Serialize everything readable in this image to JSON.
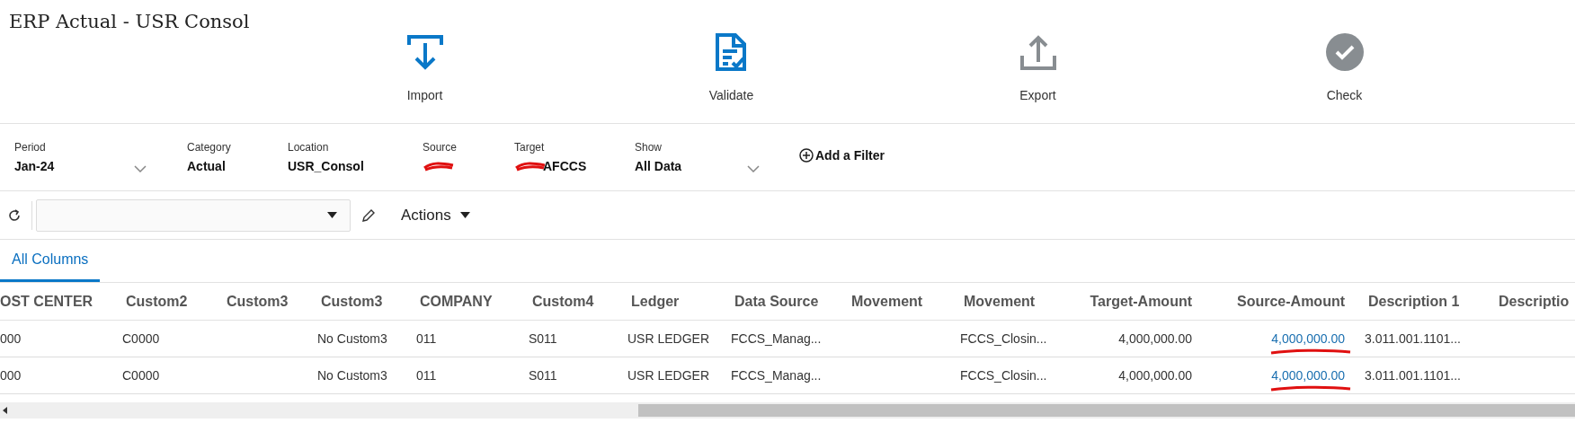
{
  "title": "ERP Actual - USR Consol",
  "actions": [
    {
      "label": "Import",
      "kind": "import",
      "disabled": false
    },
    {
      "label": "Validate",
      "kind": "validate",
      "disabled": false
    },
    {
      "label": "Export",
      "kind": "export",
      "disabled": true
    },
    {
      "label": "Check",
      "kind": "check",
      "disabled": true
    }
  ],
  "filters": [
    {
      "label": "Period",
      "value": "Jan-24",
      "dropdown": true,
      "redacted": false
    },
    {
      "label": "Category",
      "value": "Actual",
      "dropdown": false,
      "redacted": false
    },
    {
      "label": "Location",
      "value": "USR_Consol",
      "dropdown": false,
      "redacted": false
    },
    {
      "label": "Source",
      "dropdown": false,
      "redacted": true
    },
    {
      "label": "Target",
      "value": "AFCCS",
      "dropdown": false,
      "redacted": true
    },
    {
      "label": "Show",
      "value": "All Data",
      "dropdown": true,
      "redacted": false
    }
  ],
  "add_filter": {
    "label": "Add a Filter"
  },
  "toolbar": {
    "actions_label": "Actions"
  },
  "tabs": [
    {
      "label": "All Columns",
      "selected": true
    }
  ],
  "table": {
    "columns": [
      {
        "label": "OST CENTER",
        "kind": "text"
      },
      {
        "label": "Custom2",
        "kind": "text"
      },
      {
        "label": "Custom3",
        "kind": "text"
      },
      {
        "label": "Custom3",
        "kind": "text"
      },
      {
        "label": "COMPANY",
        "kind": "text"
      },
      {
        "label": "Custom4",
        "kind": "text"
      },
      {
        "label": "Ledger",
        "kind": "text"
      },
      {
        "label": "Data Source",
        "kind": "text"
      },
      {
        "label": "Movement",
        "kind": "text"
      },
      {
        "label": "Movement",
        "kind": "text"
      },
      {
        "label": "Target-Amount",
        "kind": "number"
      },
      {
        "label": "Source-Amount",
        "kind": "link"
      },
      {
        "label": "Description 1",
        "kind": "text"
      },
      {
        "label": "Descriptio",
        "kind": "text"
      }
    ],
    "rows": [
      {
        "underlined": true,
        "cells": [
          "000",
          "C0000",
          null,
          "No Custom3",
          "011",
          "S011",
          "USR LEDGER",
          "FCCS_Manag...",
          null,
          "FCCS_Closin...",
          "4,000,000.00",
          "4,000,000.00",
          "3.011.001.1101...",
          null
        ]
      },
      {
        "underlined": true,
        "cells": [
          "000",
          "C0000",
          null,
          "No Custom3",
          "011",
          "S011",
          "USR LEDGER",
          "FCCS_Manag...",
          null,
          "FCCS_Closin...",
          "4,000,000.00",
          "4,000,000.00",
          "3.011.001.1101...",
          null
        ]
      }
    ]
  }
}
